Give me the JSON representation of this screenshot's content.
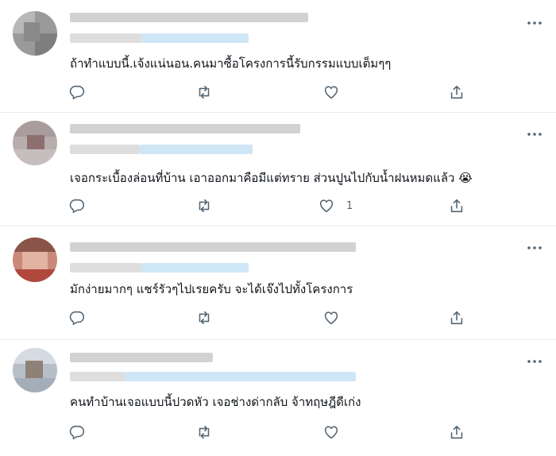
{
  "tweets": [
    {
      "text": "ถ้าทำแบบนี้.เจ้งแน่นอน.คนมาซื้อโครงการนี้รับกรรมแบบเต็มๆๆ",
      "like_count": ""
    },
    {
      "text": "เจอกระเบื้องล่อนที่บ้าน เอาออกมาคือมีแต่ทราย ส่วนปูนไปกับน้ำฝนหมดแล้ว 😭",
      "like_count": "1"
    },
    {
      "text": "มักง่ายมากๆ แชร์รัวๆไปเรยครับ จะได้เจ๊งไปทั้งโครงการ",
      "like_count": ""
    },
    {
      "text": "คนทำบ้านเจอแบบนี้ปวดหัว เจอช่างด่ากลับ จ้าทฤษฎีดีเก่ง",
      "like_count": ""
    }
  ],
  "icons": {
    "reply": "reply-icon",
    "retweet": "retweet-icon",
    "like": "heart-icon",
    "share": "share-icon",
    "more": "more-icon"
  },
  "colors": {
    "icon": "#536471",
    "divider": "#e6ecf0",
    "blurred_handle": "#cfe6f7",
    "blurred_name": "#cfcfcf"
  }
}
